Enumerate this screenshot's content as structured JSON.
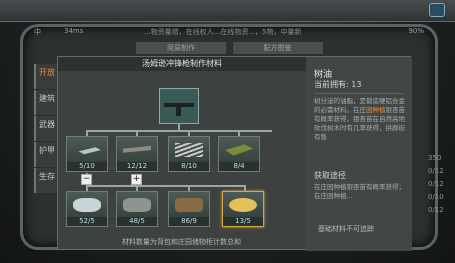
{
  "status": {
    "signal": "中",
    "ping": "34ms",
    "news": "...物资量增，在线权人...在线物资...，5物，中量新",
    "battery": "90%"
  },
  "bg_tabs": [
    "简易制作",
    "配方图鉴"
  ],
  "left_menu": [
    {
      "label": "开放",
      "active": true
    },
    {
      "label": "建筑",
      "active": false
    },
    {
      "label": "武器",
      "active": false
    },
    {
      "label": "护甲",
      "active": false
    },
    {
      "label": "生存",
      "active": false
    }
  ],
  "right_nums": [
    "350",
    "0/12",
    "0/12",
    "0/10",
    "0/12"
  ],
  "dialog": {
    "title": "汤姆逊冲锋枪制作材料",
    "tier1": [
      {
        "icon": "metal-ingot-icon",
        "count": "5/10"
      },
      {
        "icon": "pipe-icon",
        "count": "12/12"
      },
      {
        "icon": "rods-icon",
        "count": "8/10"
      },
      {
        "icon": "bullet-box-icon",
        "count": "8/4"
      }
    ],
    "tier2": [
      {
        "icon": "ore-icon",
        "count": "52/5"
      },
      {
        "icon": "stone-icon",
        "count": "48/5"
      },
      {
        "icon": "log-icon",
        "count": "86/9"
      },
      {
        "icon": "resin-icon",
        "count": "13/5",
        "selected": true
      }
    ],
    "minus": "−",
    "plus": "+",
    "footnote": "材料数量为背包和庄园储物柜计数总和"
  },
  "info": {
    "name": "树油",
    "owned_label": "当前拥有: 13",
    "desc_pre": "树分泌的油脂，是锻造硬铝合金的必需材料。在庄",
    "desc_hl": "园种植",
    "desc_post": "银杏苗有概率获得，银杏苗在自然高地砍伐树木时有几率获得，拱廊街有售",
    "source_label": "获取途径",
    "source_desc": "在庄园种植银杏苗有概率获得；在庄园种植...",
    "cannot": "基础材料不可追踪"
  }
}
